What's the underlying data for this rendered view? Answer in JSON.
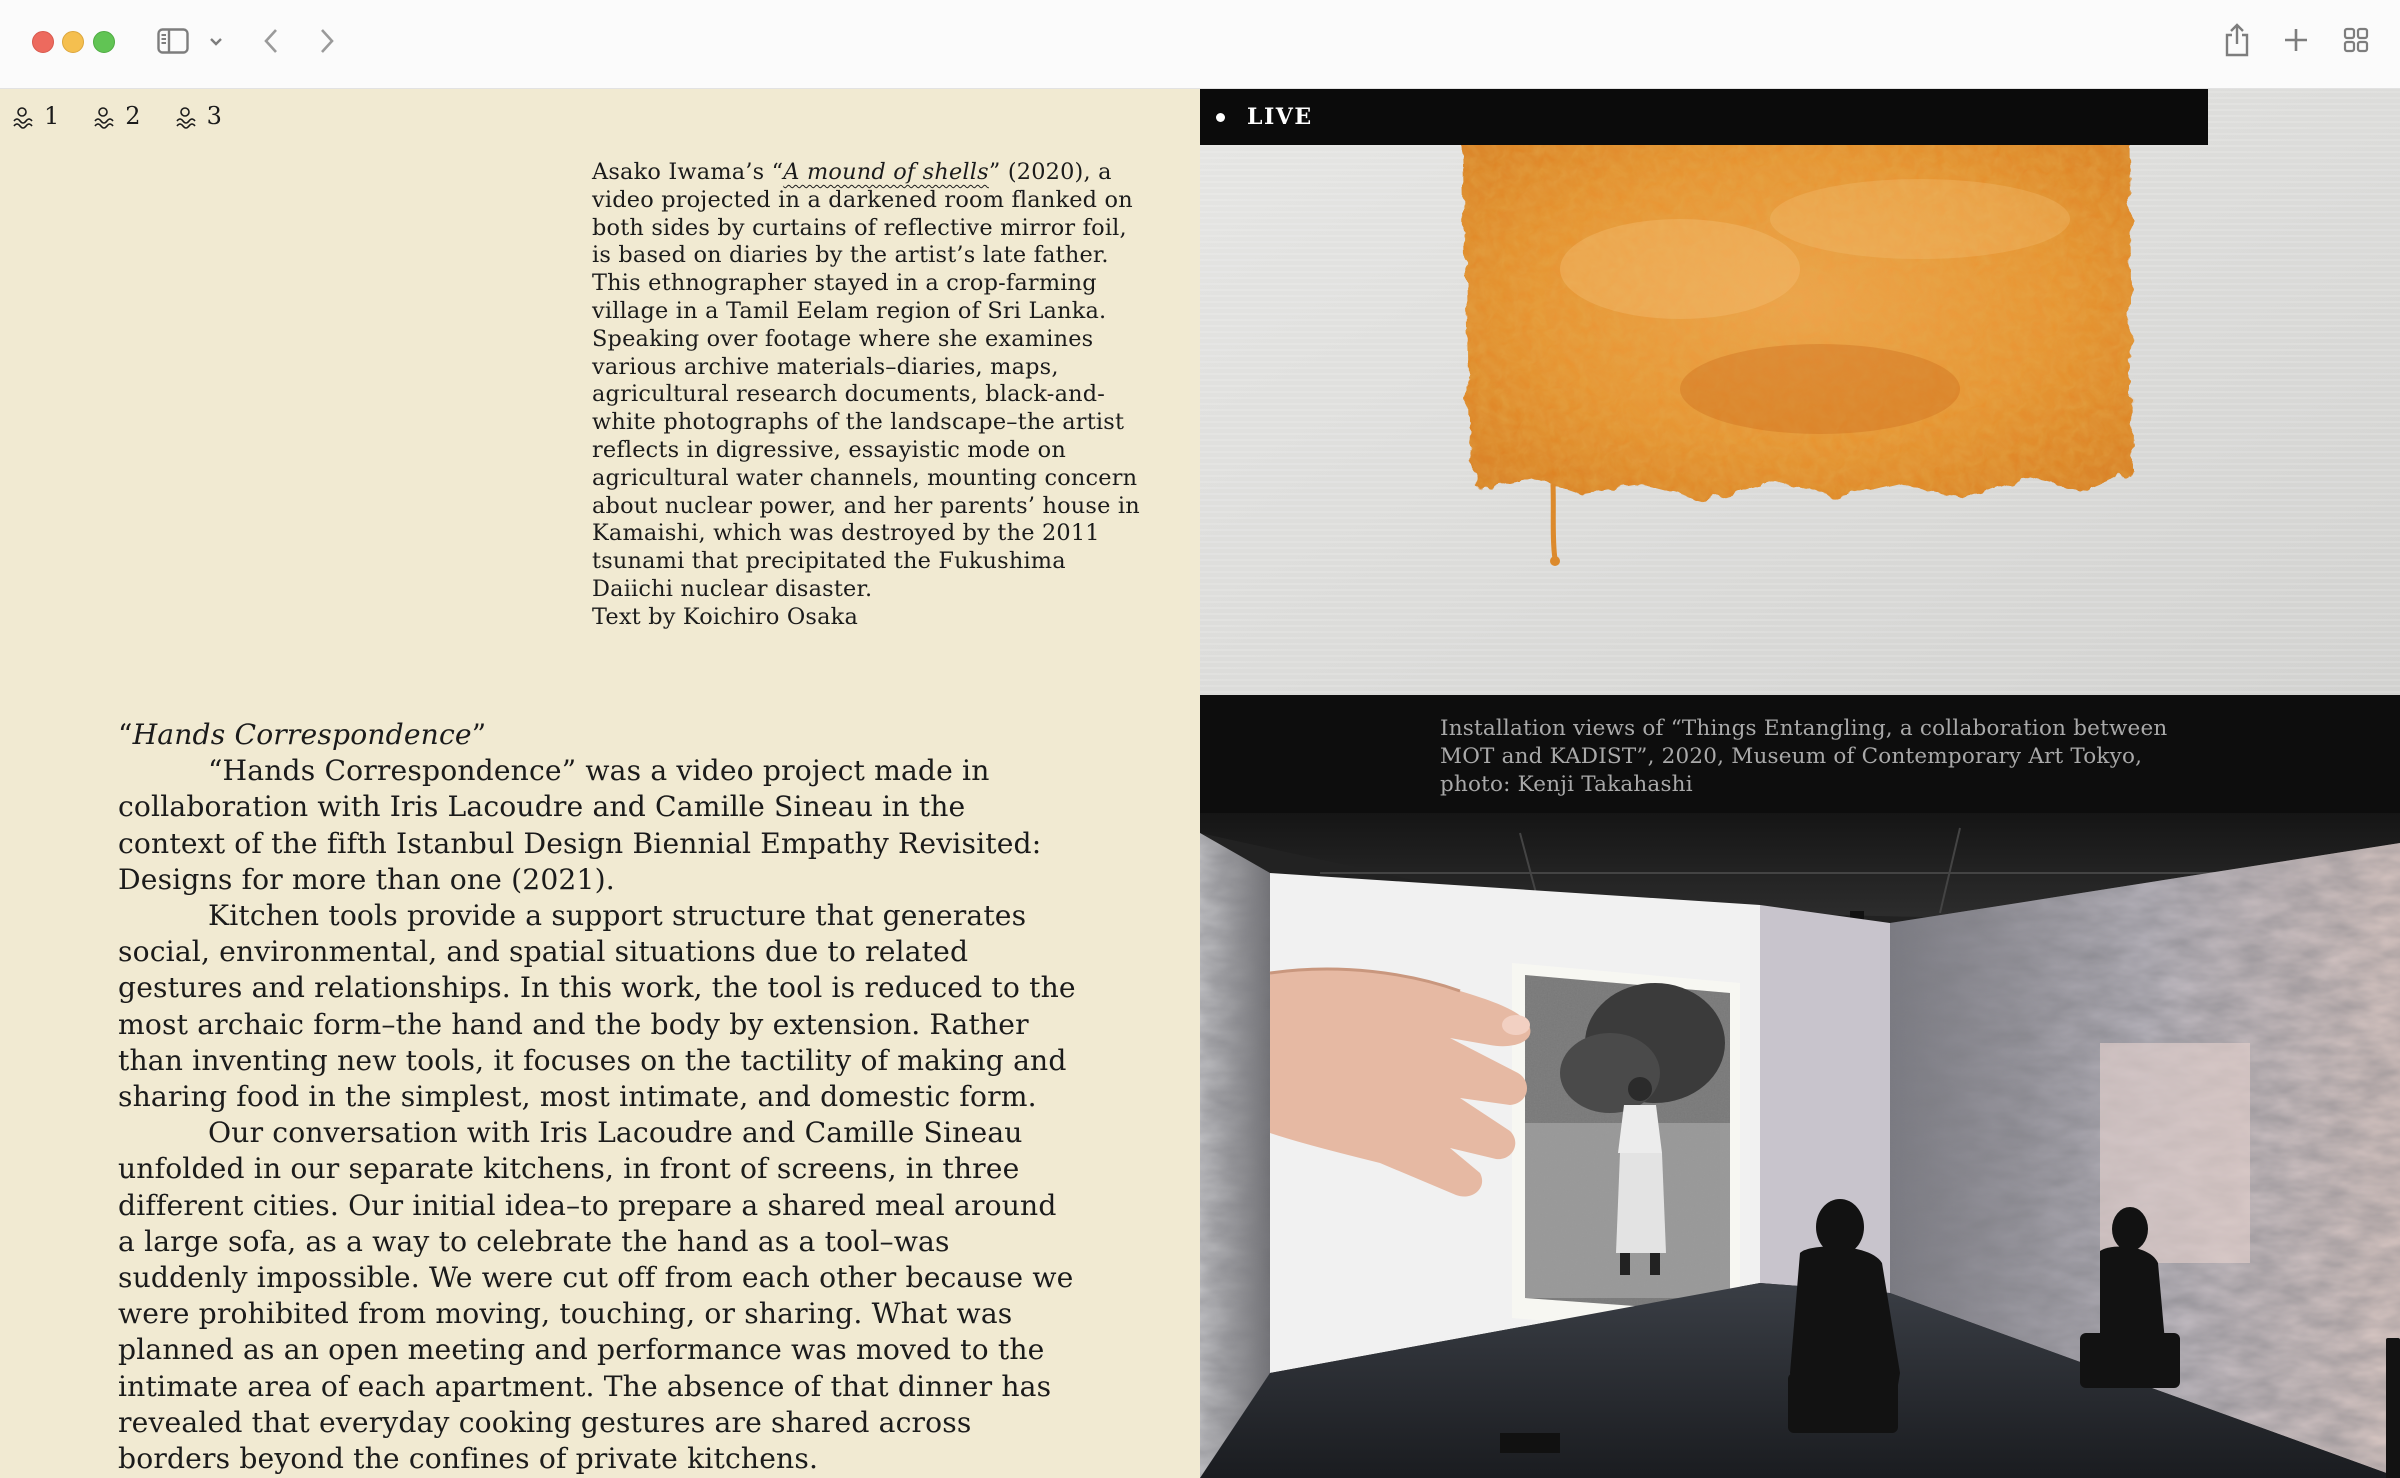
{
  "browser": {
    "icons": [
      "sidebar-icon",
      "chevron-down-icon",
      "back-icon",
      "forward-icon",
      "share-icon",
      "plus-icon",
      "tab-grid-icon"
    ]
  },
  "left": {
    "footnotes": [
      "1",
      "2",
      "3"
    ],
    "caption": {
      "pre": "Asako Iwama’s “",
      "title": "A mound of shells",
      "post": "” (2020), a video projected in a darkened room flanked on both sides by curtains of reflective mirror foil, is based on diaries by the artist’s late father. This ethnographer stayed in a crop-farming village in a Tamil Eelam region of Sri Lanka. Speaking over footage where she examines various archive materials–diaries, maps, agricultural research documents, black-and-white photographs of the landscape–the artist reflects in digressive, essayistic mode on agricultural water channels, mounting concern about nuclear power, and her parents’ house in Kamaishi, which was destroyed by the 2011 tsunami that precipitated the Fukushima Daiichi nuclear disaster.",
      "credit": "Text by Koichiro Osaka"
    },
    "essay": {
      "title_open": "“",
      "title": "Hands Correspondence",
      "title_close": "”",
      "paragraphs": [
        "“Hands Correspondence” was a video project made in collaboration with Iris Lacoudre and Camille Sineau in the context of the fifth Istanbul Design Biennial Empathy Revisited: Designs for more than one (2021).",
        "Kitchen tools provide a support structure that generates social, environmental, and spatial situations due to related gestures and relationships. In this work, the tool is reduced to the most archaic form–the hand and the body by extension. Rather than inventing new tools, it focuses on the tactility of making and sharing food in the simplest, most intimate, and domestic form.",
        "Our conversation with Iris Lacoudre and Camille Sineau unfolded in our separate kitchens, in front of screens, in three different cities. Our initial idea–to prepare a shared meal around a large sofa, as a way to celebrate the hand as a tool–was suddenly impossible. We were cut off from each other because we were prohibited from moving, touching, or sharing. What was planned as an open meeting and performance was moved to the intimate area of each apartment. The absence of that dinner has revealed that everyday cooking gestures are shared across borders beyond the confines of private kitchens."
      ]
    }
  },
  "right": {
    "live_label": "LIVE",
    "caption": "Installation views of “Things Entangling, a collaboration between MOT and KADIST”, 2020, Museum of Contemporary Art Tokyo, photo: Kenji Takahashi"
  }
}
